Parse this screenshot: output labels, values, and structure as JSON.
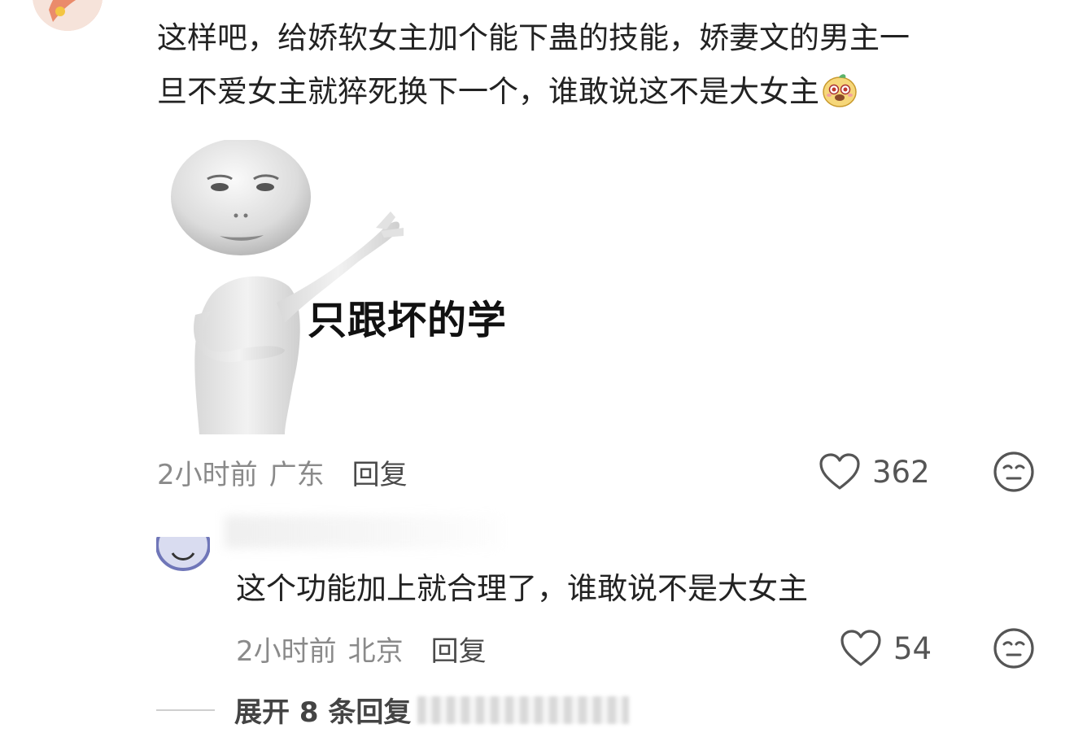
{
  "comment": {
    "text_line1": "这样吧，给娇软女主加个能下蛊的技能，娇妻文的男主一",
    "text_line2": "旦不爱女主就猝死换下一个，谁敢说这不是大女主",
    "emoji": "funny-face-emoji",
    "meme": {
      "caption": "只跟坏的学"
    },
    "time": "2小时前",
    "location": "广东",
    "reply_label": "回复",
    "likes": "362"
  },
  "reply": {
    "text": "这个功能加上就合理了，谁敢说不是大女主",
    "time": "2小时前",
    "location": "北京",
    "reply_label": "回复",
    "likes": "54"
  },
  "expand": {
    "label": "展开 8 条回复"
  },
  "colors": {
    "text": "#222222",
    "meta": "#8a8a8a",
    "icon": "#555555"
  }
}
